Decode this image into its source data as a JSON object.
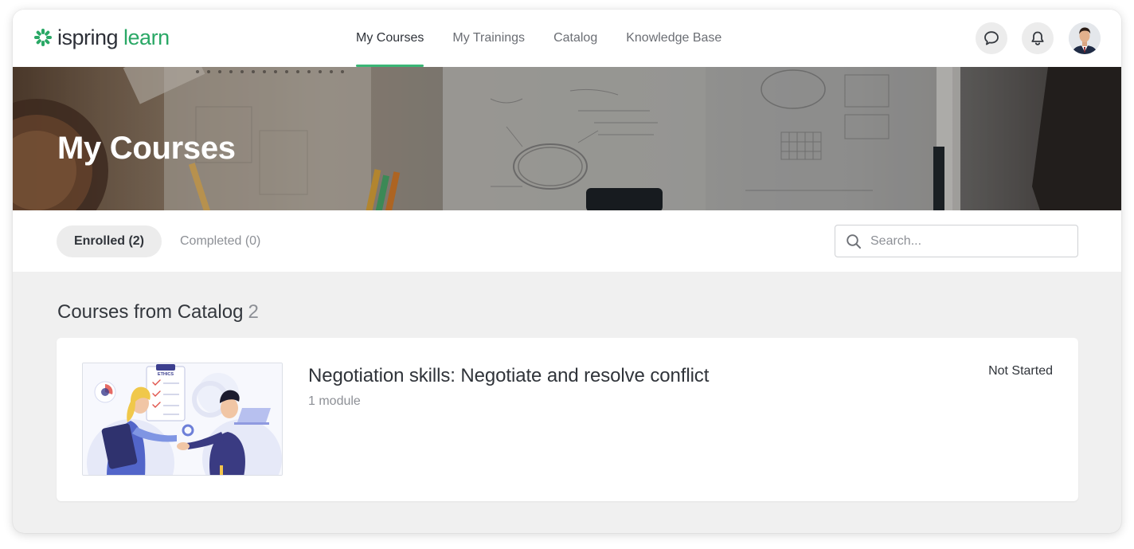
{
  "brand": {
    "name_part1": "ispring",
    "name_part2": "learn",
    "accent": "#2aa866"
  },
  "nav": {
    "items": [
      {
        "label": "My Courses",
        "active": true
      },
      {
        "label": "My Trainings",
        "active": false
      },
      {
        "label": "Catalog",
        "active": false
      },
      {
        "label": "Knowledge Base",
        "active": false
      }
    ]
  },
  "header_actions": {
    "chat_icon": "chat-bubble-icon",
    "bell_icon": "bell-icon"
  },
  "banner": {
    "title": "My Courses"
  },
  "tabs": {
    "enrolled": "Enrolled (2)",
    "completed": "Completed (0)"
  },
  "search": {
    "placeholder": "Search...",
    "value": ""
  },
  "section": {
    "title": "Courses from Catalog",
    "count": "2"
  },
  "courses": [
    {
      "title": "Negotiation skills: Negotiate and resolve conflict",
      "modules": "1 module",
      "status": "Not Started",
      "thumb_badge": "ETHICS"
    }
  ]
}
